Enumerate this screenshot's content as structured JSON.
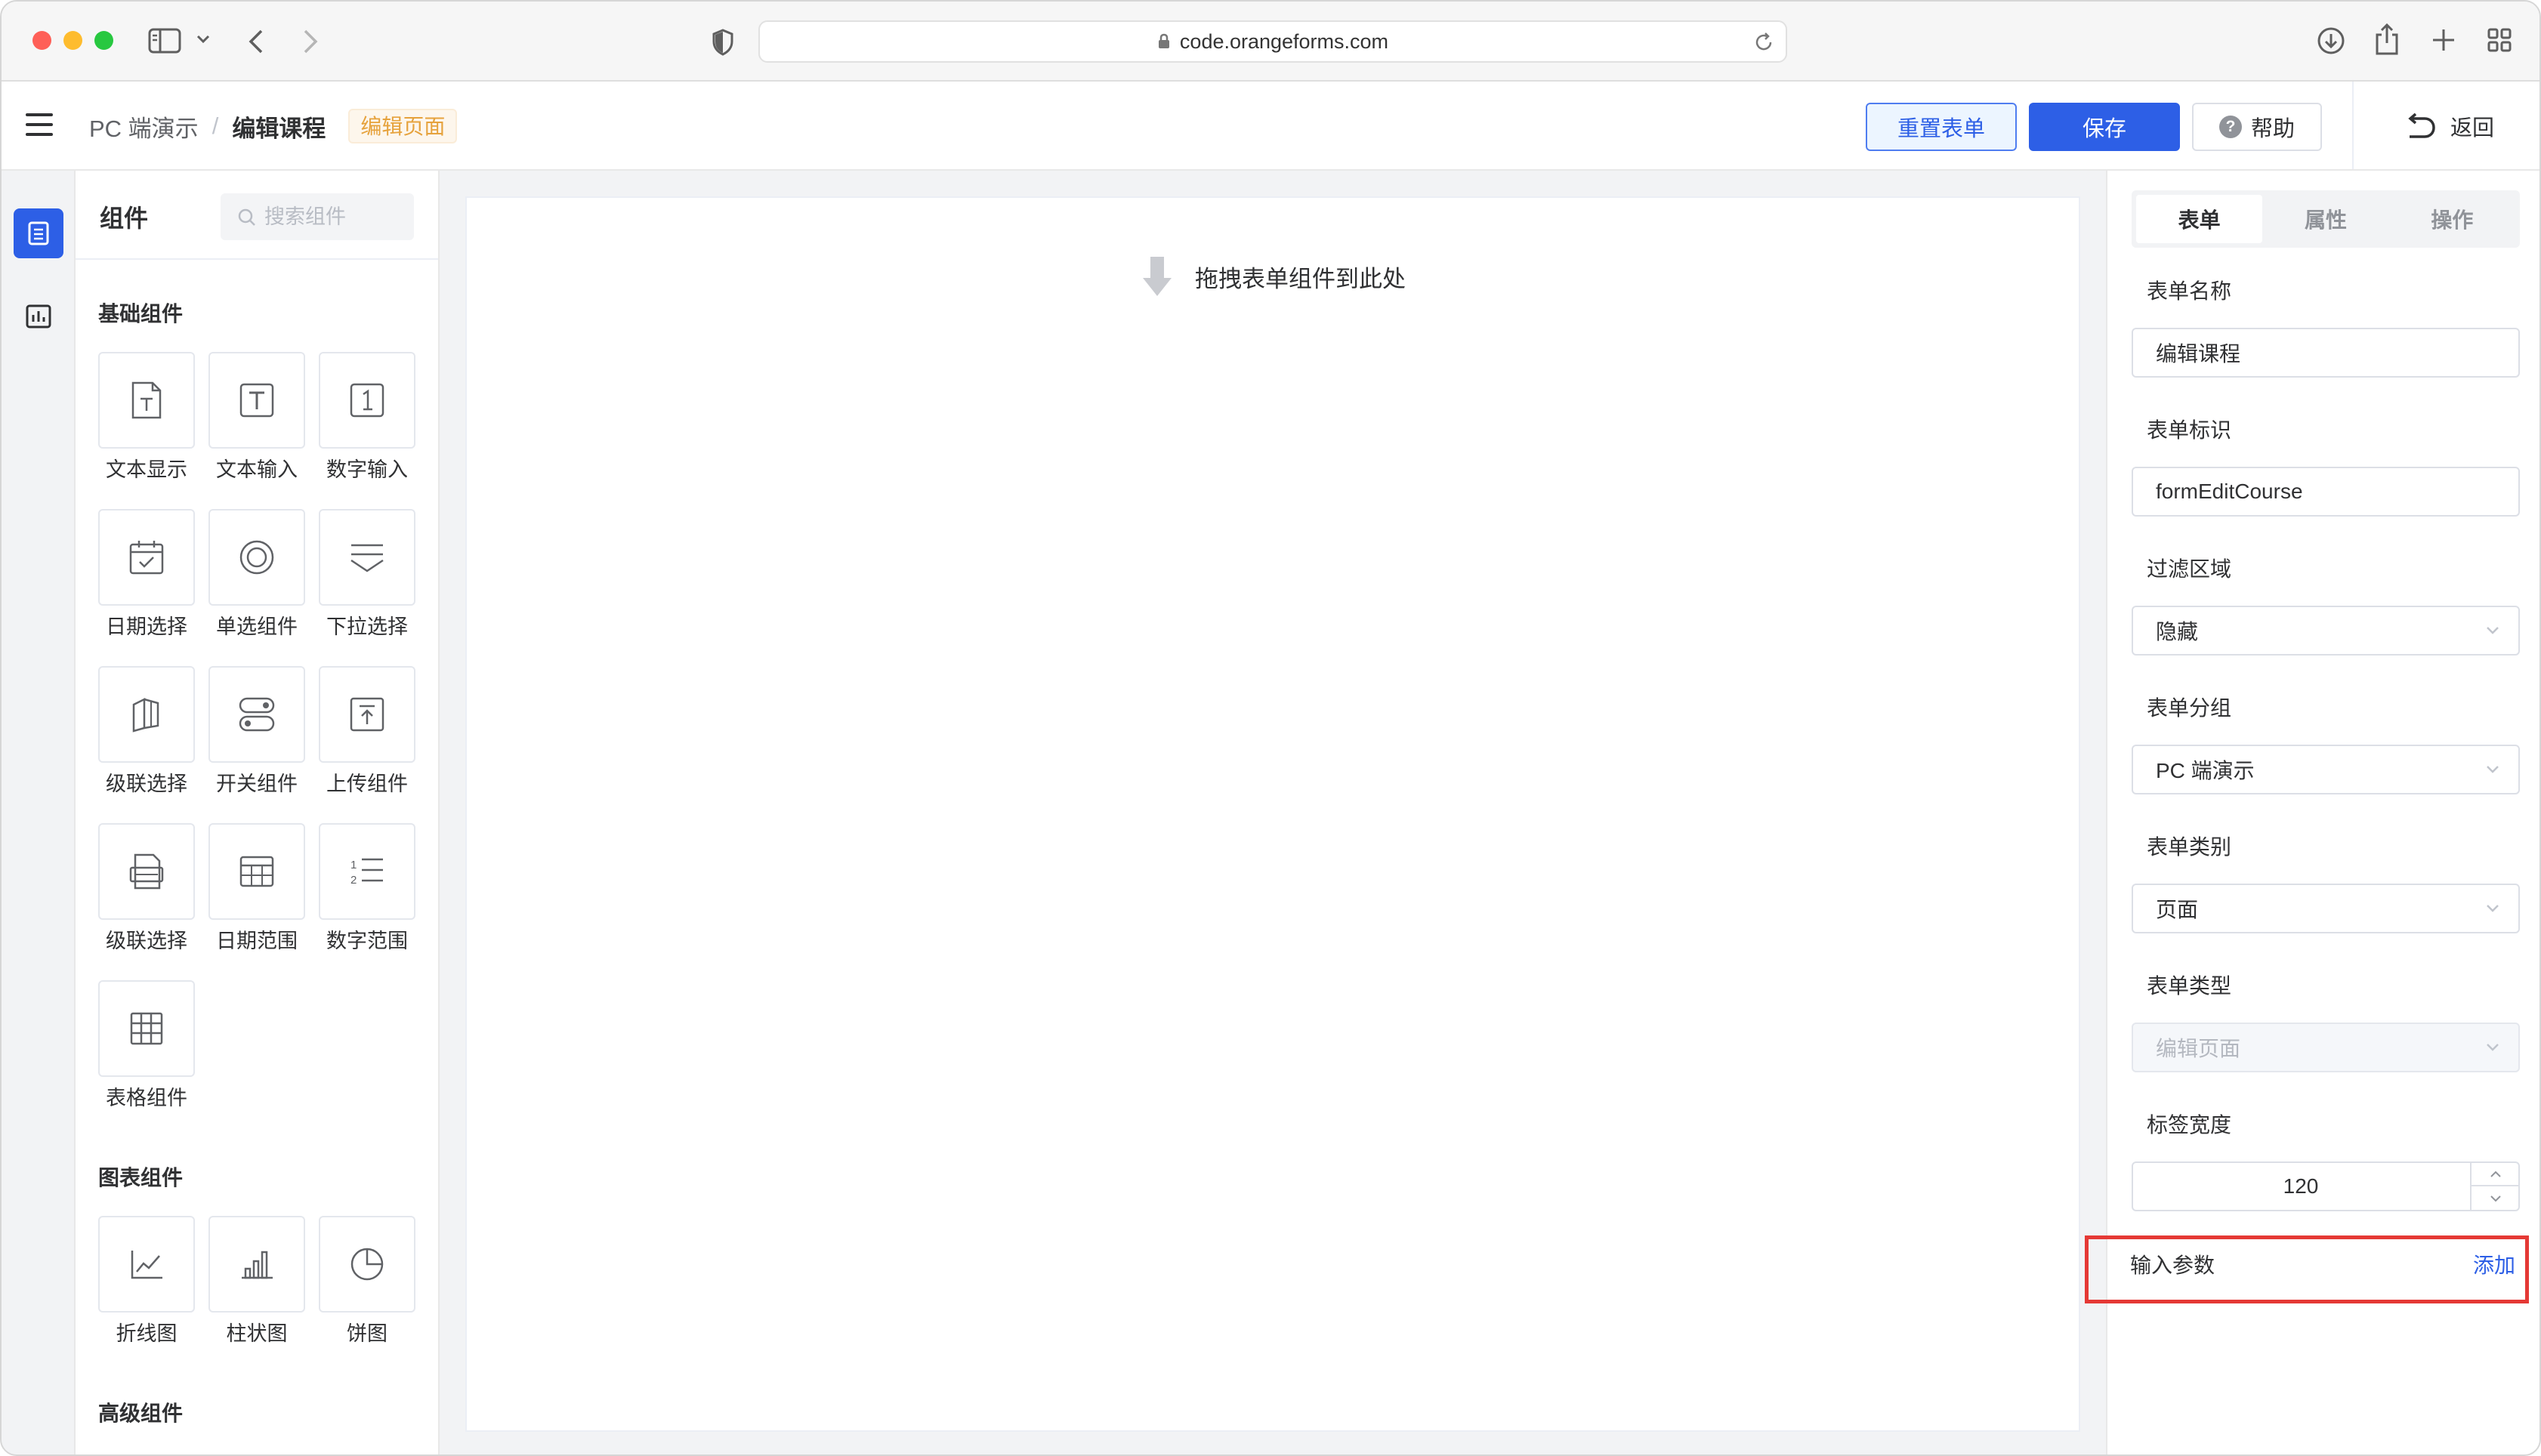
{
  "browser": {
    "url": "code.orangeforms.com"
  },
  "header": {
    "breadcrumb": [
      "PC 端演示",
      "/",
      "编辑课程"
    ],
    "page_tag": "编辑页面",
    "buttons": {
      "reset": "重置表单",
      "save": "保存",
      "help": "帮助"
    },
    "back": "返回",
    "colors": {
      "primary": "#2d5fe6",
      "tag": "#e6a23c"
    }
  },
  "rail": {
    "items": [
      {
        "icon": "form-icon",
        "active": true
      },
      {
        "icon": "chart-icon",
        "active": false
      }
    ]
  },
  "palette": {
    "title": "组件",
    "search_placeholder": "搜索组件",
    "sections": [
      {
        "title": "基础组件",
        "items": [
          {
            "label": "文本显示",
            "icon": "text-display-icon"
          },
          {
            "label": "文本输入",
            "icon": "text-input-icon"
          },
          {
            "label": "数字输入",
            "icon": "number-input-icon"
          },
          {
            "label": "日期选择",
            "icon": "calendar-icon"
          },
          {
            "label": "单选组件",
            "icon": "radio-icon"
          },
          {
            "label": "下拉选择",
            "icon": "dropdown-icon"
          },
          {
            "label": "级联选择",
            "icon": "cascader-icon"
          },
          {
            "label": "开关组件",
            "icon": "switch-icon"
          },
          {
            "label": "上传组件",
            "icon": "upload-icon"
          },
          {
            "label": "级联选择",
            "icon": "rich-text-icon"
          },
          {
            "label": "日期范围",
            "icon": "date-range-icon"
          },
          {
            "label": "数字范围",
            "icon": "number-range-icon"
          },
          {
            "label": "表格组件",
            "icon": "table-icon"
          }
        ]
      },
      {
        "title": "图表组件",
        "items": [
          {
            "label": "折线图",
            "icon": "line-chart-icon"
          },
          {
            "label": "柱状图",
            "icon": "bar-chart-icon"
          },
          {
            "label": "饼图",
            "icon": "pie-chart-icon"
          }
        ]
      },
      {
        "title": "高级组件",
        "items": []
      }
    ]
  },
  "canvas": {
    "drop_hint": "拖拽表单组件到此处"
  },
  "props": {
    "tabs": [
      "表单",
      "属性",
      "操作"
    ],
    "active_tab": 0,
    "fields": {
      "form_name": {
        "label": "表单名称",
        "value": "编辑课程"
      },
      "form_id": {
        "label": "表单标识",
        "value": "formEditCourse"
      },
      "filter_area": {
        "label": "过滤区域",
        "value": "隐藏"
      },
      "form_group": {
        "label": "表单分组",
        "value": "PC 端演示"
      },
      "form_category": {
        "label": "表单类别",
        "value": "页面"
      },
      "form_type": {
        "label": "表单类型",
        "value": "编辑页面"
      },
      "label_width": {
        "label": "标签宽度",
        "value": "120"
      }
    },
    "input_params": {
      "label": "输入参数",
      "add": "添加"
    },
    "highlight_color": "#e53935"
  }
}
